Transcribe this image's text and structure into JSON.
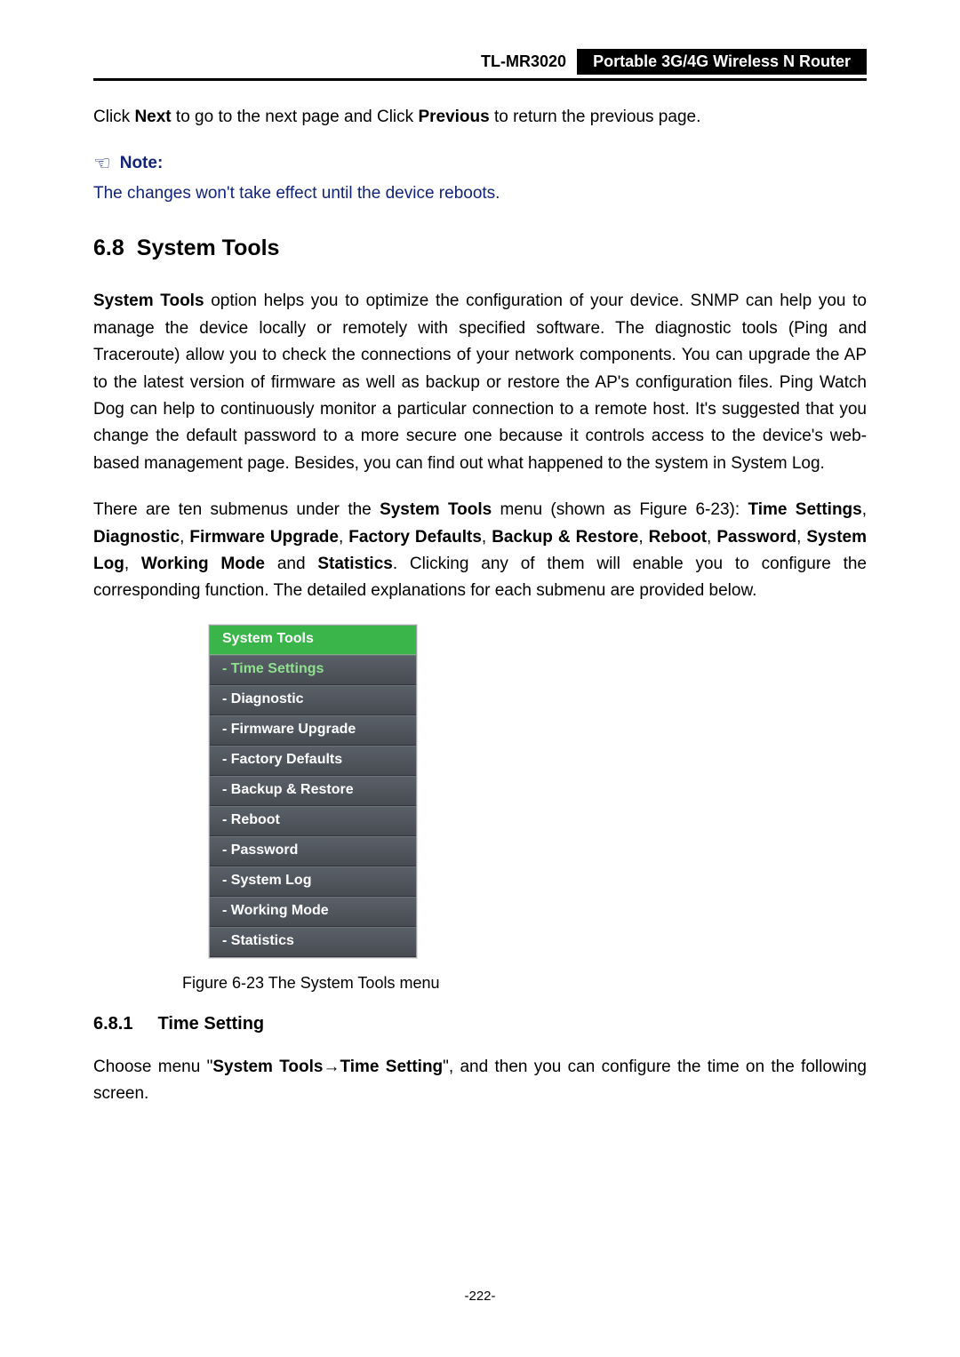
{
  "header": {
    "model": "TL-MR3020",
    "title": "Portable 3G/4G Wireless N Router"
  },
  "intro_sentence": {
    "pre": "Click ",
    "next": "Next",
    "mid": " to go to the next page and Click ",
    "prev": "Previous",
    "post": " to return the previous page."
  },
  "note": {
    "label": "Note:",
    "text": "The changes won't take effect until the device reboots."
  },
  "section": {
    "num": "6.8",
    "title": "System Tools"
  },
  "para1": {
    "lead": "System Tools",
    "rest": " option helps you to optimize the configuration of your device. SNMP can help you to manage the device locally or remotely with specified software. The diagnostic tools (Ping and Traceroute) allow you to check the connections of your network components. You can upgrade the AP to the latest version of firmware as well as backup or restore the AP's configuration files. Ping Watch Dog can help to continuously monitor a particular connection to a remote host. It's suggested that you change the default password to a more secure one because it controls access to the device's web-based management page. Besides, you can find out what happened to the system in System Log."
  },
  "para2": {
    "a": "There are ten submenus under the ",
    "b": "System Tools",
    "c": " menu (shown as Figure 6-23): ",
    "list": "Time Settings, Diagnostic, Firmware Upgrade, Factory Defaults, Backup & Restore, Reboot, Password, System Log, Working Mode and Statistics",
    "d": ". Clicking any of them will enable you to configure the corresponding function. The detailed explanations for each submenu are provided below."
  },
  "menu": {
    "header": "System Tools",
    "items": [
      "- Time Settings",
      "- Diagnostic",
      "- Firmware Upgrade",
      "- Factory Defaults",
      "- Backup & Restore",
      "- Reboot",
      "- Password",
      "- System Log",
      "- Working Mode",
      "- Statistics"
    ],
    "active_index": 0
  },
  "figure_caption": "Figure 6-23 The System Tools menu",
  "subsection": {
    "num": "6.8.1",
    "title": "Time Setting"
  },
  "para3": {
    "a": "Choose menu \"",
    "b": "System Tools",
    "arrow": "→",
    "c": "Time Setting",
    "d": "\", and then you can configure the time on the following screen."
  },
  "page_number": "-222-"
}
